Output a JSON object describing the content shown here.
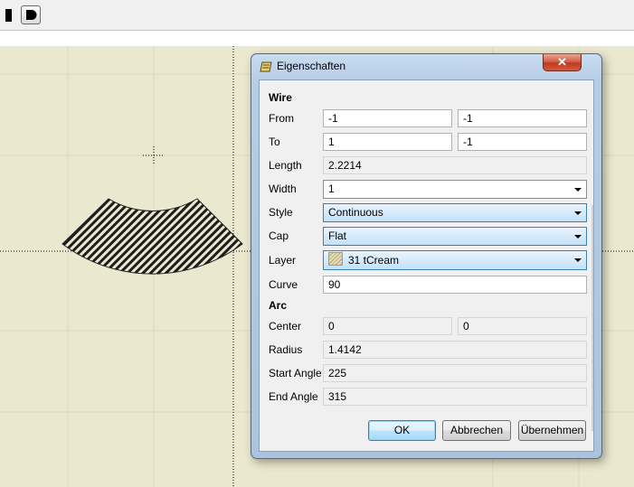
{
  "toolbar": {
    "buttons": [
      "stop-icon",
      "d-shape-icon"
    ]
  },
  "dialog": {
    "title": "Eigenschaften",
    "close_icon": "close-icon",
    "wire": {
      "heading": "Wire",
      "from_label": "From",
      "from_x": "-1",
      "from_y": "-1",
      "to_label": "To",
      "to_x": "1",
      "to_y": "-1",
      "length_label": "Length",
      "length": "2.2214",
      "width_label": "Width",
      "width": "1",
      "style_label": "Style",
      "style": "Continuous",
      "cap_label": "Cap",
      "cap": "Flat",
      "layer_label": "Layer",
      "layer": "31 tCream",
      "curve_label": "Curve",
      "curve": "90"
    },
    "arc": {
      "heading": "Arc",
      "center_label": "Center",
      "center_x": "0",
      "center_y": "0",
      "radius_label": "Radius",
      "radius": "1.4142",
      "start_angle_label": "Start Angle",
      "start_angle": "225",
      "end_angle_label": "End Angle",
      "end_angle": "315"
    },
    "buttons": {
      "ok": "OK",
      "cancel": "Abbrechen",
      "apply": "Übernehmen"
    }
  },
  "colors": {
    "canvas_bg": "#ebe8d0",
    "grid": "#dcd9bf",
    "hatch": "#1e1e1e"
  }
}
